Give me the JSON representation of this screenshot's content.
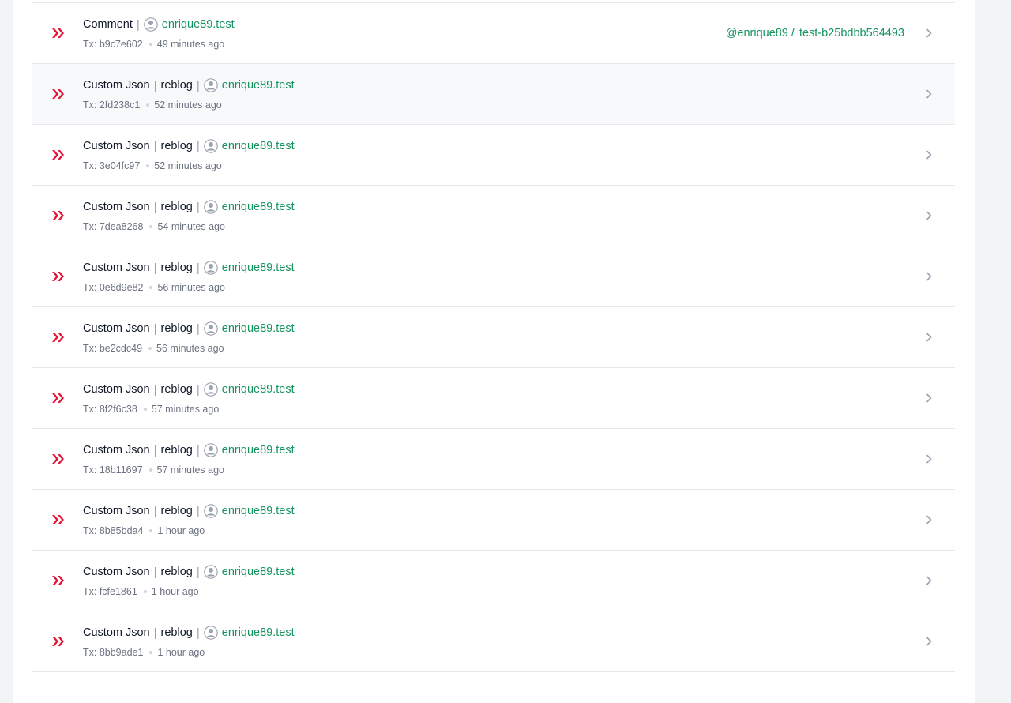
{
  "colors": {
    "accent": "#15935f",
    "hive_red": "#e31337",
    "muted": "#6b7280"
  },
  "icons": {
    "row_logo": "hive-logo-icon",
    "avatar": "user-avatar-icon",
    "chevron": "chevron-right-icon"
  },
  "operations": [
    {
      "op": "Comment",
      "detail": "",
      "user": "enrique89.test",
      "tx": "Tx: b9c7e602",
      "time": "49 minutes ago",
      "target_author": "@enrique89",
      "target_permlink": "test-b25bdbb564493",
      "target_sep": "/"
    },
    {
      "op": "Custom Json",
      "detail": "reblog",
      "user": "enrique89.test",
      "tx": "Tx: 2fd238c1",
      "time": "52 minutes ago"
    },
    {
      "op": "Custom Json",
      "detail": "reblog",
      "user": "enrique89.test",
      "tx": "Tx: 3e04fc97",
      "time": "52 minutes ago"
    },
    {
      "op": "Custom Json",
      "detail": "reblog",
      "user": "enrique89.test",
      "tx": "Tx: 7dea8268",
      "time": "54 minutes ago"
    },
    {
      "op": "Custom Json",
      "detail": "reblog",
      "user": "enrique89.test",
      "tx": "Tx: 0e6d9e82",
      "time": "56 minutes ago"
    },
    {
      "op": "Custom Json",
      "detail": "reblog",
      "user": "enrique89.test",
      "tx": "Tx: be2cdc49",
      "time": "56 minutes ago"
    },
    {
      "op": "Custom Json",
      "detail": "reblog",
      "user": "enrique89.test",
      "tx": "Tx: 8f2f6c38",
      "time": "57 minutes ago"
    },
    {
      "op": "Custom Json",
      "detail": "reblog",
      "user": "enrique89.test",
      "tx": "Tx: 18b11697",
      "time": "57 minutes ago"
    },
    {
      "op": "Custom Json",
      "detail": "reblog",
      "user": "enrique89.test",
      "tx": "Tx: 8b85bda4",
      "time": "1 hour ago"
    },
    {
      "op": "Custom Json",
      "detail": "reblog",
      "user": "enrique89.test",
      "tx": "Tx: fcfe1861",
      "time": "1 hour ago"
    },
    {
      "op": "Custom Json",
      "detail": "reblog",
      "user": "enrique89.test",
      "tx": "Tx: 8bb9ade1",
      "time": "1 hour ago"
    }
  ]
}
